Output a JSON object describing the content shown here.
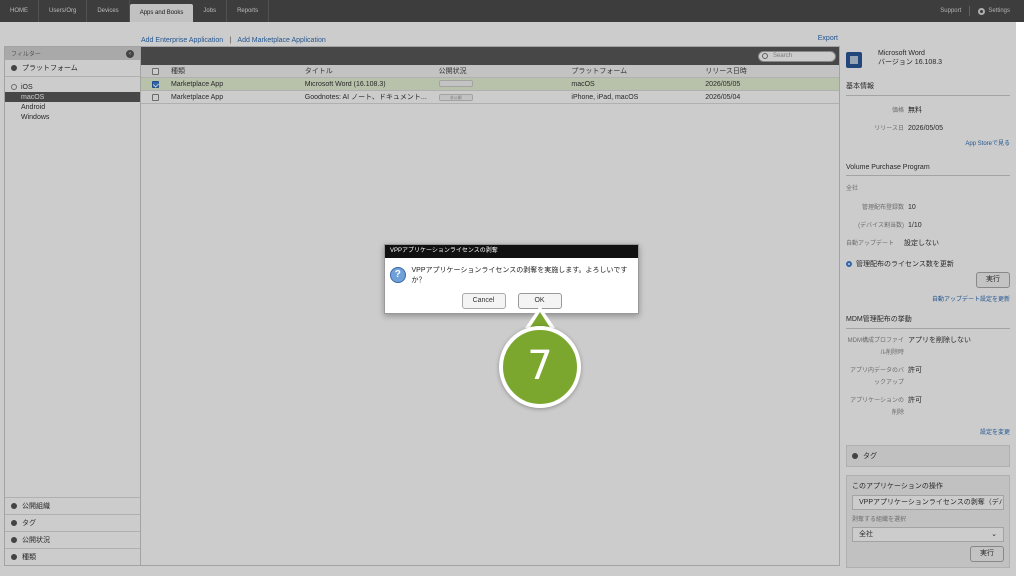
{
  "topnav": {
    "tabs": [
      "HOME",
      "Users/Org",
      "Devices",
      "Apps and Books",
      "Jobs",
      "Reports"
    ],
    "active_tab": "Apps and Books",
    "support": "Support",
    "settings": "Settings"
  },
  "actions": {
    "add_enterprise": "Add Enterprise Application",
    "separator": "|",
    "add_marketplace": "Add Marketplace Application",
    "export": "Export"
  },
  "sidebar": {
    "filter_title": "フィルター",
    "platform_section": "プラットフォーム",
    "ios": "iOS",
    "items": [
      "macOS",
      "Android",
      "Windows"
    ],
    "selected": "macOS",
    "bottom_sections": [
      "公開組織",
      "タグ",
      "公開状況",
      "種類"
    ]
  },
  "table": {
    "search_placeholder": "Search",
    "headers": [
      "種類",
      "タイトル",
      "公開状況",
      "プラットフォーム",
      "リリース日時"
    ],
    "rows": [
      {
        "type": "Marketplace App",
        "title": "Microsoft Word (16.108.3)",
        "status": "",
        "platform": "macOS",
        "release": "2026/05/05",
        "checked": true
      },
      {
        "type": "Marketplace App",
        "title": "Goodnotes: AI ノート、ドキュメント...",
        "status": "非公開",
        "platform": "iPhone, iPad, macOS",
        "release": "2026/05/04",
        "checked": false
      }
    ]
  },
  "detail": {
    "app_name": "Microsoft Word",
    "version": "バージョン 16.108.3",
    "basic_info": "基本情報",
    "price_label": "価格",
    "price": "無料",
    "release_label": "リリース日",
    "release": "2026/05/05",
    "appstore_link": "App Storeで見る",
    "vpp_title": "Volume Purchase Program",
    "vpp_scope": "全社",
    "managed_count_label": "管理配布登録数",
    "managed_count": "10",
    "device_count_label": "(デバイス割当数)",
    "device_count": "1/10",
    "auto_update_label": "自動アップデート",
    "auto_update": "設定しない",
    "update_license": "管理配布のライセンス数を更新",
    "run_button": "実行",
    "auto_update_link": "自動アップデート設定を更新",
    "mdm_title": "MDM管理配布の挙動",
    "mdm_profile_label": "MDM構成プロファイル削除時",
    "mdm_profile": "アプリを削除しない",
    "backup_label": "アプリ内データのバックアップ",
    "backup": "許可",
    "delete_label": "アプリケーションの削除",
    "delete": "許可",
    "settings_link": "設定を変更",
    "tag_section": "タグ",
    "ops_title": "このアプリケーションの操作",
    "ops_field": "VPPアプリケーションライセンスの剥奪（デバ",
    "org_label": "剥奪する組織を選択",
    "org_value": "全社",
    "ops_run": "実行"
  },
  "dialog": {
    "title": "VPPアプリケーションライセンスの剥奪",
    "message": "VPPアプリケーションライセンスの剥奪を実施します。よろしいですか？",
    "cancel": "Cancel",
    "ok": "OK"
  },
  "callout": {
    "number": "7",
    "color": "#7ba72f"
  }
}
